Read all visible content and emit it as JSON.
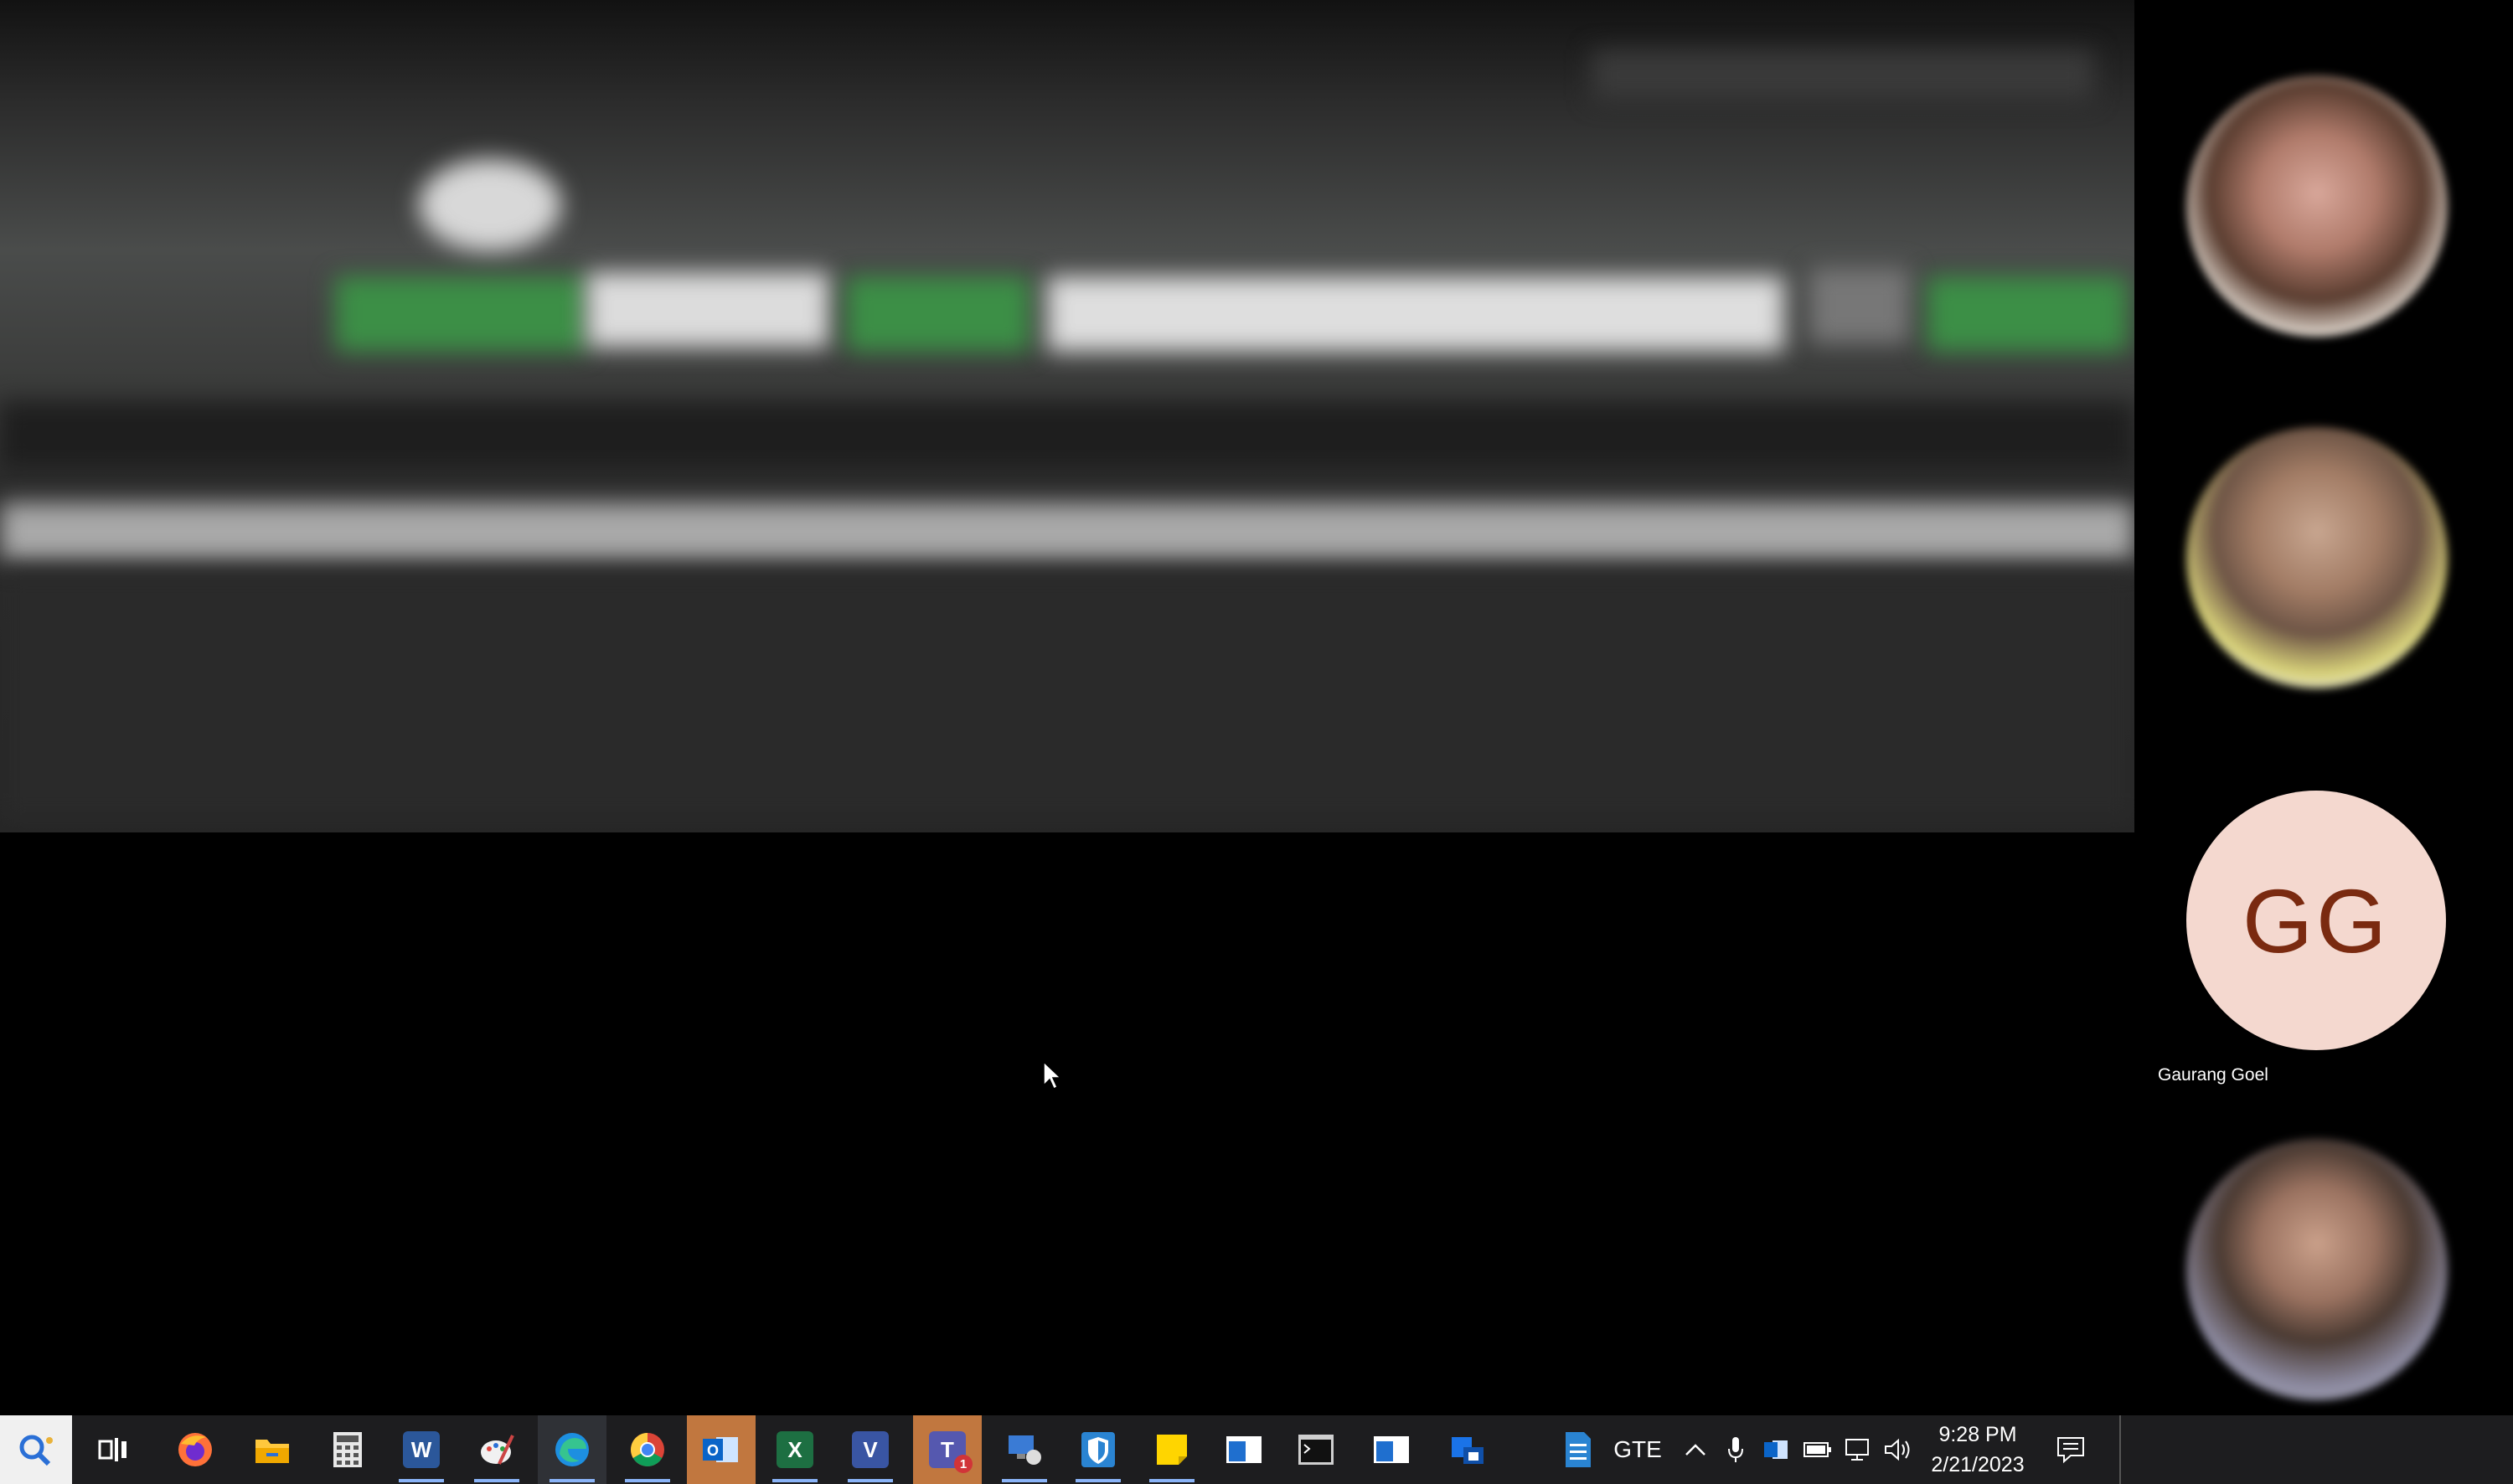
{
  "participants": [
    {
      "name": "",
      "type": "photo"
    },
    {
      "name": "",
      "type": "photo"
    },
    {
      "name": "Gaurang Goel",
      "type": "initials",
      "initials": "GG"
    },
    {
      "name": "",
      "type": "photo"
    }
  ],
  "taskbar": {
    "apps": [
      {
        "name": "search-button",
        "icon": "search-icon"
      },
      {
        "name": "task-view-button",
        "icon": "task-view-icon"
      },
      {
        "name": "firefox",
        "icon": "firefox-icon"
      },
      {
        "name": "file-explorer",
        "icon": "folder-icon"
      },
      {
        "name": "calculator",
        "icon": "calculator-icon"
      },
      {
        "name": "word",
        "icon": "word-icon",
        "glyph": "W"
      },
      {
        "name": "paint",
        "icon": "paint-icon"
      },
      {
        "name": "edge",
        "icon": "edge-icon"
      },
      {
        "name": "chrome",
        "icon": "chrome-icon"
      },
      {
        "name": "outlook",
        "icon": "outlook-icon"
      },
      {
        "name": "excel",
        "icon": "excel-icon",
        "glyph": "X"
      },
      {
        "name": "visio",
        "icon": "visio-icon",
        "glyph": "V"
      },
      {
        "name": "teams",
        "icon": "teams-icon",
        "glyph": "T",
        "badge": "1"
      },
      {
        "name": "remote-desktop",
        "icon": "remote-desktop-icon"
      },
      {
        "name": "defender",
        "icon": "shield-icon"
      },
      {
        "name": "sticky-notes",
        "icon": "sticky-notes-icon"
      },
      {
        "name": "app-window-1",
        "icon": "window-icon"
      },
      {
        "name": "terminal",
        "icon": "terminal-icon"
      },
      {
        "name": "app-window-2",
        "icon": "window-icon"
      },
      {
        "name": "outlook-calendar",
        "icon": "outlook-calendar-icon"
      }
    ],
    "tray": {
      "document_icon": "document-icon",
      "language": "GTE",
      "show_hidden": "^",
      "time": "9:28 PM",
      "date": "2/21/2023"
    },
    "colors": {
      "background": "#1d1d1f",
      "active_indicator": "#8ab4f8",
      "highlight": "#c1773f"
    }
  },
  "avatar_colors": {
    "initials_bg": "#f4d8cf",
    "initials_fg": "#7a2a10"
  }
}
